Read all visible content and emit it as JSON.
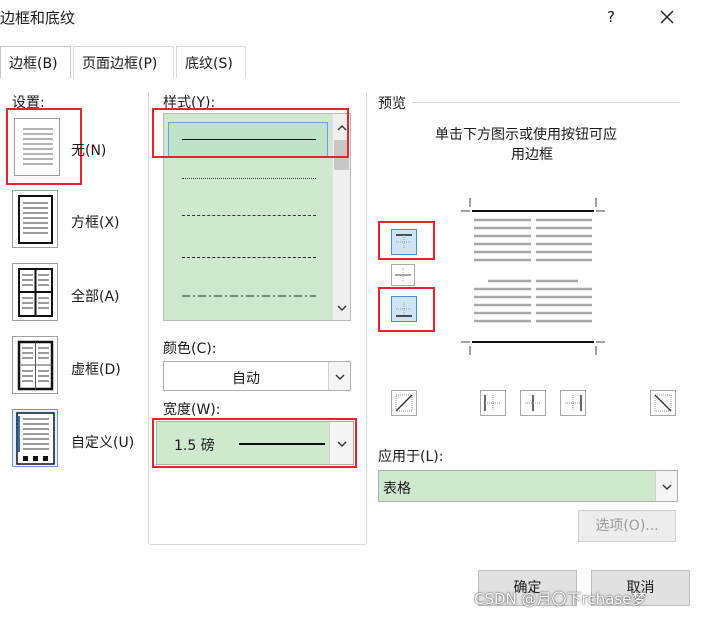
{
  "window": {
    "title": "边框和底纹",
    "help": "?",
    "close_icon": "close-icon"
  },
  "tabs": [
    {
      "label": "边框(B)",
      "active": true
    },
    {
      "label": "页面边框(P)",
      "active": false
    },
    {
      "label": "底纹(S)",
      "active": false
    }
  ],
  "settings": {
    "heading": "设置:",
    "items": [
      {
        "label": "无(N)",
        "icon": "border-none-icon",
        "selected": false
      },
      {
        "label": "方框(X)",
        "icon": "border-box-icon",
        "selected": false
      },
      {
        "label": "全部(A)",
        "icon": "border-all-icon",
        "selected": false
      },
      {
        "label": "虚框(D)",
        "icon": "border-grid-icon",
        "selected": false
      },
      {
        "label": "自定义(U)",
        "icon": "border-custom-icon",
        "selected": true
      }
    ]
  },
  "style": {
    "heading": "样式(Y):",
    "items": [
      "solid",
      "dotted",
      "dashed-fine",
      "dashed",
      "dash-dot"
    ],
    "selected": "solid"
  },
  "color": {
    "heading": "颜色(C):",
    "value": "自动"
  },
  "width": {
    "heading": "宽度(W):",
    "value": "1.5 磅"
  },
  "preview": {
    "heading": "预览",
    "hint_line1": "单击下方图示或使用按钮可应",
    "hint_line2": "用边框"
  },
  "apply_to": {
    "heading": "应用于(L):",
    "value": "表格"
  },
  "buttons": {
    "options": "选项(O)...",
    "ok": "确定",
    "cancel": "取消"
  },
  "watermark": "CSDN @月〇下rchase梦",
  "colors": {
    "highlight_red": "#e8242a",
    "list_green": "#cfe9cf",
    "selection_blue": "#6fa0d8"
  }
}
